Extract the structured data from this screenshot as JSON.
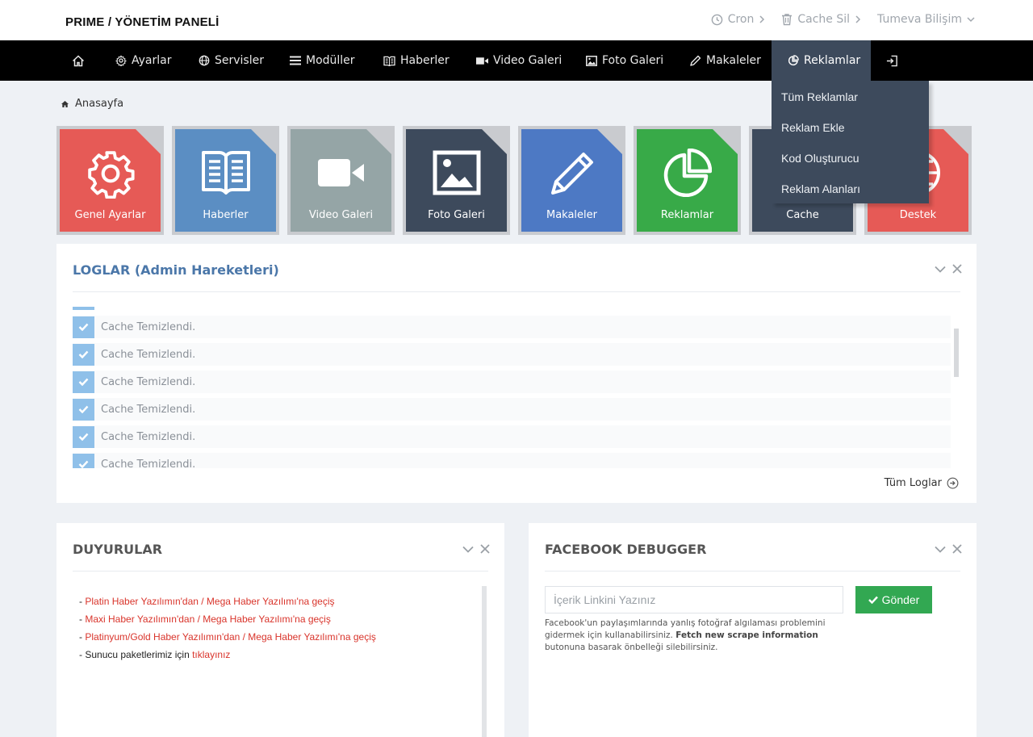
{
  "header": {
    "brand": "PRIME / YÖNETİM PANELİ",
    "links": {
      "cron": "Cron",
      "cache": "Cache Sil",
      "user": "Tumeva Bilişim"
    }
  },
  "nav": {
    "items": [
      {
        "label": "Ayarlar",
        "icon": "gear-icon"
      },
      {
        "label": "Servisler",
        "icon": "globe-icon"
      },
      {
        "label": "Modüller",
        "icon": "list-icon"
      },
      {
        "label": "Haberler",
        "icon": "book-icon"
      },
      {
        "label": "Video Galeri",
        "icon": "video-icon"
      },
      {
        "label": "Foto Galeri",
        "icon": "image-icon"
      },
      {
        "label": "Makaleler",
        "icon": "pencil-icon"
      },
      {
        "label": "Reklamlar",
        "icon": "pie-icon"
      }
    ],
    "active": "Reklamlar"
  },
  "dropdown": {
    "items": [
      "Tüm Reklamlar",
      "Reklam Ekle",
      "Kod Oluşturucu",
      "Reklam Alanları"
    ]
  },
  "breadcrumb": {
    "home": "Anasayfa"
  },
  "tiles": [
    {
      "label": "Genel Ayarlar",
      "color": "#e65a56",
      "icon": "gear-icon"
    },
    {
      "label": "Haberler",
      "color": "#5b8ec3",
      "icon": "book-icon"
    },
    {
      "label": "Video Galeri",
      "color": "#95a5a6",
      "icon": "video-icon"
    },
    {
      "label": "Foto Galeri",
      "color": "#3d4a5c",
      "icon": "image-icon"
    },
    {
      "label": "Makaleler",
      "color": "#4d79c4",
      "icon": "pencil-icon"
    },
    {
      "label": "Reklamlar",
      "color": "#38aa48",
      "icon": "pie-icon"
    },
    {
      "label": "Cache",
      "color": "#3d4a5c",
      "icon": "cache-icon"
    },
    {
      "label": "Destek",
      "color": "#e65a56",
      "icon": "support-icon"
    }
  ],
  "logs": {
    "title": "LOGLAR (Admin Hareketleri)",
    "entries": [
      "Cache Temizlendi.",
      "Cache Temizlendi.",
      "Cache Temizlendi.",
      "Cache Temizlendi.",
      "Cache Temizlendi.",
      "Cache Temizlendi."
    ],
    "all_link": "Tüm Loglar"
  },
  "announcements": {
    "title": "DUYURULAR",
    "items": [
      {
        "prefix": "- ",
        "text": "Platin Haber Yazılımın'dan / Mega Haber Yazılımı'na geçiş",
        "link": ""
      },
      {
        "prefix": "- ",
        "text": "Maxi Haber Yazılımın'dan / Mega Haber Yazılımı'na geçiş",
        "link": ""
      },
      {
        "prefix": "- ",
        "text": "Platinyum/Gold Haber Yazılımın'dan / Mega Haber Yazılımı'na geçiş",
        "link": ""
      },
      {
        "prefix": "- ",
        "text": "Sunucu paketlerimiz için ",
        "link": "tıklayınız"
      }
    ]
  },
  "facebook": {
    "title": "FACEBOOK DEBUGGER",
    "placeholder": "İçerik Linkini Yazınız",
    "button": "Gönder",
    "help_1": "Facebook'un paylaşımlarında yanlış fotoğraf algılaması problemini gidermek için kullanabilirsiniz. ",
    "help_bold": "Fetch new scrape information",
    "help_2": " butonuna basarak önbelleği silebilirsiniz."
  },
  "colors": {
    "nav_bg": "#000000",
    "nav_active": "#3d4a5c",
    "title_blue": "#4b77a9",
    "check_blue": "#8fc0e9",
    "success_green": "#32a852",
    "announce_red": "#d9342b"
  }
}
